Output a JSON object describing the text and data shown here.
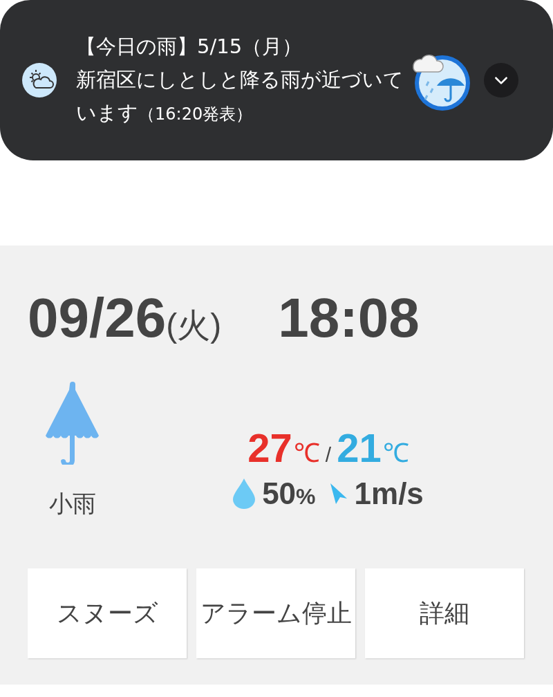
{
  "notification": {
    "title": "【今日の雨】5/15（月）",
    "message": "新宿区にしとしと降る雨が近づいています",
    "issued": "（16:20発表）",
    "expanded": false
  },
  "alarm": {
    "date": "09/26",
    "weekday": "(火)",
    "time": "18:08"
  },
  "weather": {
    "condition": "小雨",
    "high": {
      "value": "27",
      "unit": "℃"
    },
    "separator": "/",
    "low": {
      "value": "21",
      "unit": "℃"
    },
    "humidity": {
      "value": "50",
      "unit": "%"
    },
    "wind": "1m/s"
  },
  "buttons": [
    {
      "label": "スヌーズ"
    },
    {
      "label": "アラーム停止"
    },
    {
      "label": "詳細"
    }
  ]
}
